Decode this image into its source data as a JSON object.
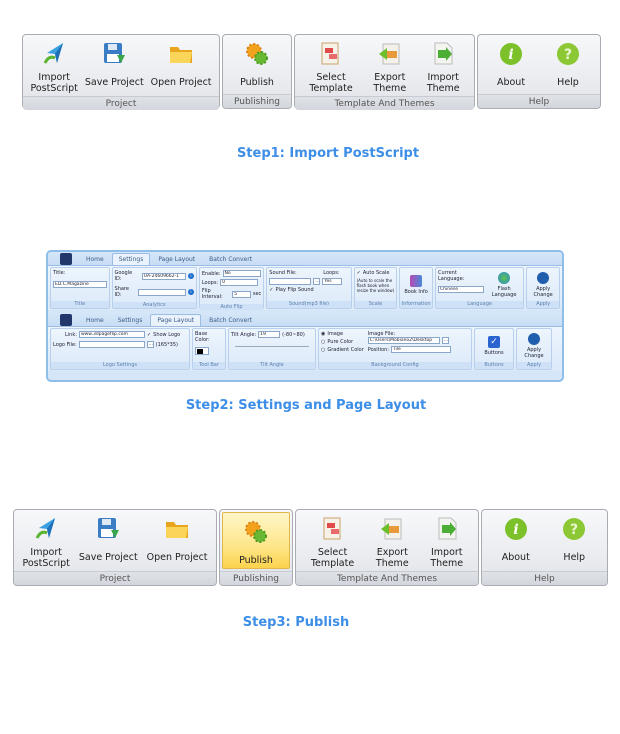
{
  "ribbon1": {
    "groups": [
      {
        "label": "Project",
        "buttons": [
          {
            "label_l1": "Import",
            "label_l2": "PostScript",
            "icon": "import-postscript-icon"
          },
          {
            "label_l1": "Save Project",
            "icon": "save-icon"
          },
          {
            "label_l1": "Open Project",
            "icon": "open-folder-icon"
          }
        ]
      },
      {
        "label": "Publishing",
        "buttons": [
          {
            "label_l1": "Publish",
            "icon": "gears-icon"
          }
        ]
      },
      {
        "label": "Template  And Themes",
        "buttons": [
          {
            "label_l1": "Select",
            "label_l2": "Template",
            "icon": "template-icon"
          },
          {
            "label_l1": "Export",
            "label_l2": "Theme",
            "icon": "export-theme-icon"
          },
          {
            "label_l1": "Import",
            "label_l2": "Theme",
            "icon": "import-theme-icon"
          }
        ]
      },
      {
        "label": "Help",
        "buttons": [
          {
            "label_l1": "About",
            "icon": "info-icon"
          },
          {
            "label_l1": "Help",
            "icon": "help-icon"
          }
        ]
      }
    ]
  },
  "steps": {
    "step1": "Step1: Import PostScript",
    "step2": "Step2: Settings and Page Layout",
    "step3": "Step3: Publish"
  },
  "settings_ribbon": {
    "tabs": [
      "Home",
      "Settings",
      "Page Layout",
      "Batch Convert"
    ],
    "active_tab": "Settings",
    "title_label": "Title:",
    "title_value": "ED.C.Magazine",
    "title_group": "Title",
    "google_id_label": "Google ID:",
    "google_id_value": "UA-24609662-1",
    "share_id_label": "Share ID:",
    "share_id_value": "",
    "analytics_group": "Analytics",
    "enable_label": "Enable:",
    "enable_value": "No",
    "loops_label": "Loops:",
    "loops_value": "0",
    "flip_interval_label": "Flip Interval:",
    "flip_interval_value": "5",
    "flip_interval_unit": "sec",
    "autoflip_group": "Auto Flip",
    "sound_file_label": "Sound File:",
    "sound_file_value": "",
    "sound_loops_label": "Loops:",
    "sound_loops_value": "Yes",
    "play_flip_sound": "Play Flip Sound",
    "sound_group": "Sound(mp3 file)",
    "auto_scale": "Auto Scale",
    "auto_scale_note": "(Auto to scale the flash book when resize the window)",
    "scale_group": "Scale",
    "book_info": "Book Info",
    "information_group": "Information",
    "current_language_label": "Current Language:",
    "current_language_value": "Chinese",
    "flash_language": "Flash Language",
    "language_group": "Language",
    "apply_change": "Apply Change",
    "apply_group": "Apply"
  },
  "layout_ribbon": {
    "tabs": [
      "Home",
      "Settings",
      "Page Layout",
      "Batch Convert"
    ],
    "active_tab": "Page Layout",
    "link_label": "Link:",
    "link_value": "www.3dpageflip.com",
    "show_logo": "Show Logo",
    "logo_file_label": "Logo File:",
    "logo_file_value": "",
    "logo_size": "(165*35)",
    "logo_group": "Logo Settings",
    "base_color_label": "Base Color:",
    "base_color_value": "#000000",
    "toolbar_group": "Tool Bar",
    "tilt_angle_label": "Tilt Angle:",
    "tilt_angle_value": "19",
    "tilt_range": "(-80~80)",
    "tilt_group": "Tilt Angle",
    "bg_options": [
      "Image",
      "Pure Color",
      "Gradient Color"
    ],
    "bg_selected": "Image",
    "image_file_label": "Image File:",
    "image_file_value": "C:\\Users\\Mobiano2\\Desktop",
    "position_label": "Position:",
    "position_value": "Tile",
    "bg_group": "Background Config",
    "buttons": "Buttons",
    "buttons_group": "Buttons",
    "apply_change": "Apply Change",
    "apply_group": "Apply"
  }
}
